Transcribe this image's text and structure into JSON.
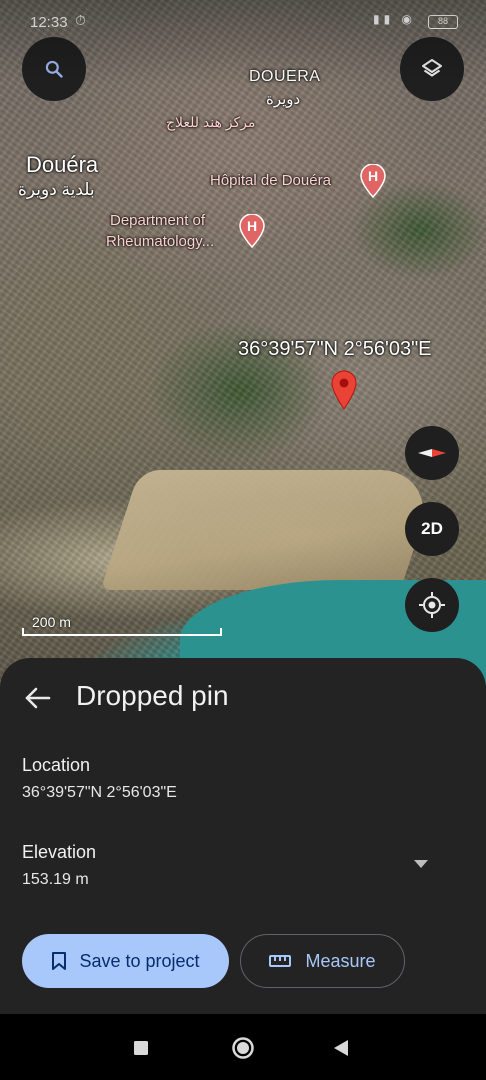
{
  "status_bar": {
    "time": "12:33",
    "battery": "88"
  },
  "map": {
    "labels": {
      "town_latin": "Douéra",
      "town_arabic": "بلدية دويرة",
      "district_latin": "DOUERA",
      "district_arabic": "دويرة",
      "center_arabic": "مركز هند للعلاج",
      "hospital": "Hôpital de Douéra",
      "dept_line1": "Department of",
      "dept_line2": "Rheumatology..."
    },
    "pin_coordinates": "36°39'57\"N 2°56'03\"E",
    "scale": "200 m",
    "mode_button": "2D",
    "accent_color": "#a8c7fa",
    "pin_color": "#ea4335"
  },
  "sheet": {
    "title": "Dropped pin",
    "location_label": "Location",
    "location_value": "36°39'57\"N 2°56'03\"E",
    "elevation_label": "Elevation",
    "elevation_value": "153.19 m",
    "save_button": "Save to project",
    "measure_button": "Measure"
  },
  "icons": [
    "search-icon",
    "layers-icon",
    "compass-icon",
    "my-location-icon",
    "back-arrow-icon",
    "bookmark-icon",
    "ruler-icon",
    "dropdown-icon",
    "map-pin-icon",
    "hospital-icon"
  ]
}
